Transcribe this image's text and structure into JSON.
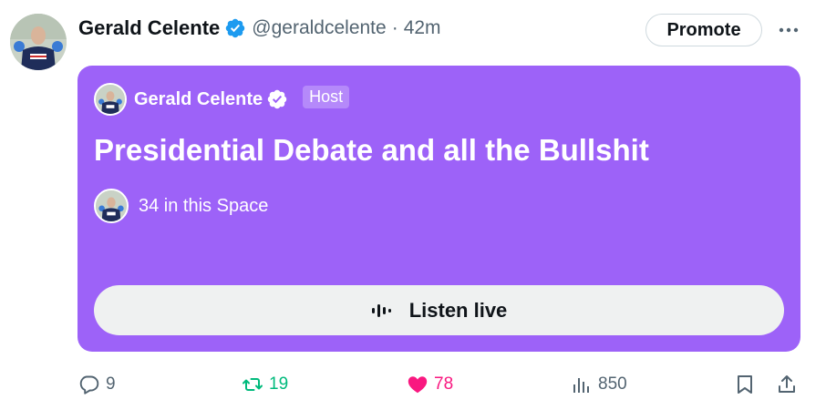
{
  "author": {
    "display_name": "Gerald Celente",
    "handle": "@geraldcelente",
    "separator": "·",
    "time": "42m",
    "avatar_icon": "profile-photo",
    "verified_icon": "verified-badge-icon"
  },
  "header_actions": {
    "promote_label": "Promote",
    "more_icon": "more-dots-icon"
  },
  "space": {
    "host_name": "Gerald Celente",
    "host_label": "Host",
    "title": "Presidential Debate and all the Bullshit",
    "listeners_text": "34 in this Space",
    "listen_label": "Listen live",
    "listen_icon": "audio-waveform-icon",
    "card_color": "#9d62f8"
  },
  "actions": {
    "reply_count": "9",
    "retweet_count": "19",
    "like_count": "78",
    "views_count": "850",
    "reply_icon": "reply-bubble-icon",
    "retweet_icon": "retweet-icon",
    "like_icon": "heart-icon",
    "views_icon": "views-bar-chart-icon",
    "bookmark_icon": "bookmark-icon",
    "share_icon": "share-icon",
    "retweet_color": "#00ba7c",
    "like_color": "#f91880"
  }
}
